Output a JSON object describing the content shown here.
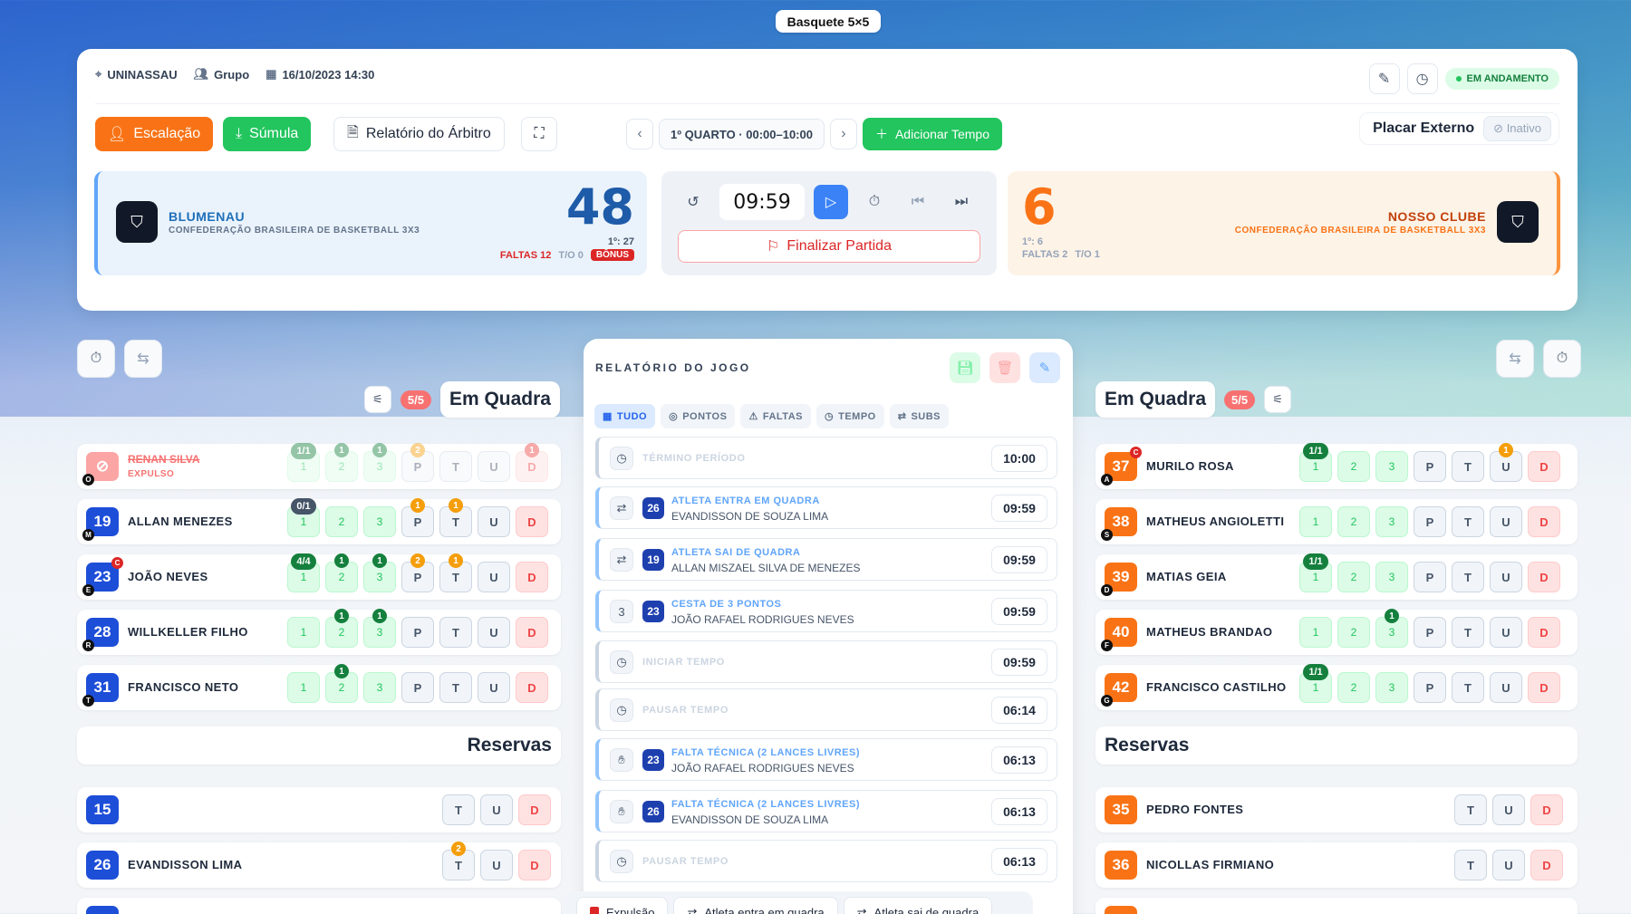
{
  "app": {
    "title": "Basquete 5×5"
  },
  "header": {
    "location": "UNINASSAU",
    "group": "Grupo",
    "datetime": "16/10/2023 14:30",
    "status": "EM ANDAMENTO"
  },
  "toolbar": {
    "escalacao": "Escalação",
    "sumula": "Súmula",
    "relatorio": "Relatório do Árbitro",
    "period": "1º QUARTO · 00:00–10:00",
    "add_time": "Adicionar Tempo",
    "placar_externo": "Placar Externo",
    "placar_state": "Inativo"
  },
  "teamA": {
    "name": "BLUMENAU",
    "sub": "CONFEDERAÇÃO BRASILEIRA DE BASKETBALL 3X3",
    "score": "48",
    "q": "1º: 27",
    "faltas": "FALTAS 12",
    "to": "T/O 0",
    "bonus": "BÔNUS"
  },
  "teamB": {
    "name": "NOSSO CLUBE",
    "sub": "CONFEDERAÇÃO BRASILEIRA DE BASKETBALL 3X3",
    "score": "6",
    "q": "1º: 6",
    "faltas": "FALTAS 2",
    "to": "T/O 1"
  },
  "clock": {
    "time": "09:59",
    "finalizar": "Finalizar Partida"
  },
  "left": {
    "title": "Em Quadra",
    "count": "5/5",
    "reservas": "Reservas"
  },
  "right": {
    "title": "Em Quadra",
    "count": "5/5",
    "reservas": "Reservas"
  },
  "keys": {
    "p1": "1",
    "p2": "2",
    "p3": "3",
    "P": "P",
    "T": "T",
    "U": "U",
    "D": "D"
  },
  "leftPlayers": [
    {
      "num": "",
      "name": "RENAN SILVA",
      "status": "EXPULSO",
      "pos": "O"
    },
    {
      "num": "19",
      "name": "ALLAN MENEZES",
      "pos": "M"
    },
    {
      "num": "23",
      "name": "JOÃO NEVES",
      "pos": "E",
      "cap": "C"
    },
    {
      "num": "28",
      "name": "WILLKELLER FILHO",
      "pos": "R"
    },
    {
      "num": "31",
      "name": "FRANCISCO NETO",
      "pos": "T"
    }
  ],
  "leftBadges": {
    "r0_1": "1/1",
    "r0_2": "1",
    "r0_3": "1",
    "r0_P": "2",
    "r0_D": "1",
    "r1_1": "0/1",
    "r1_P": "1",
    "r1_T": "1",
    "r2_1": "4/4",
    "r2_2": "1",
    "r2_3": "1",
    "r2_P": "2",
    "r2_T": "1",
    "r3_2": "1",
    "r3_3": "1",
    "r4_2": "1"
  },
  "leftReserves": [
    {
      "num": "15",
      "name": ""
    },
    {
      "num": "26",
      "name": "EVANDISSON LIMA",
      "badge": "2"
    }
  ],
  "rightPlayers": [
    {
      "num": "37",
      "name": "MURILO ROSA",
      "pos": "A",
      "cap": "C"
    },
    {
      "num": "38",
      "name": "MATHEUS ANGIOLETTI",
      "pos": "S"
    },
    {
      "num": "39",
      "name": "MATIAS GEIA",
      "pos": "D"
    },
    {
      "num": "40",
      "name": "MATHEUS BRANDAO",
      "pos": "F"
    },
    {
      "num": "42",
      "name": "FRANCISCO CASTILHO",
      "pos": "G"
    }
  ],
  "rightBadges": {
    "r0_1": "1/1",
    "r0_U": "1",
    "r2_1": "1/1",
    "r3_3": "1",
    "r4_1": "1/1"
  },
  "rightReserves": [
    {
      "num": "35",
      "name": "PEDRO FONTES"
    },
    {
      "num": "36",
      "name": "NICOLLAS FIRMIANO"
    }
  ],
  "report": {
    "title": "RELATÓRIO DO JOGO",
    "tabs": [
      "TUDO",
      "PONTOS",
      "FALTAS",
      "TEMPO",
      "SUBS"
    ],
    "events": [
      {
        "icon": "clock-icon",
        "title": "TÉRMINO PERÍODO",
        "time": "10:00",
        "gray": true
      },
      {
        "icon": "swap-icon",
        "num": "26",
        "title": "ATLETA ENTRA EM QUADRA",
        "who": "EVANDISSON DE SOUZA LIMA",
        "time": "09:59"
      },
      {
        "icon": "swap-icon",
        "num": "19",
        "title": "ATLETA SAI DE QUADRA",
        "who": "ALLAN MISZAEL SILVA DE MENEZES",
        "time": "09:59"
      },
      {
        "icon": "three-icon",
        "iconText": "3",
        "num": "23",
        "title": "CESTA DE 3 PONTOS",
        "who": "JOÃO RAFAEL RODRIGUES NEVES",
        "time": "09:59"
      },
      {
        "icon": "clock-icon",
        "title": "INICIAR TEMPO",
        "time": "09:59",
        "gray": true
      },
      {
        "icon": "clock-icon",
        "title": "PAUSAR TEMPO",
        "time": "06:14",
        "gray": true
      },
      {
        "icon": "hand-icon",
        "num": "23",
        "title": "FALTA TÉCNICA (2 LANCES LIVRES)",
        "who": "JOÃO RAFAEL RODRIGUES NEVES",
        "time": "06:13"
      },
      {
        "icon": "hand-icon",
        "num": "26",
        "title": "FALTA TÉCNICA (2 LANCES LIVRES)",
        "who": "EVANDISSON DE SOUZA LIMA",
        "time": "06:13"
      },
      {
        "icon": "clock-icon",
        "title": "PAUSAR TEMPO",
        "time": "06:13",
        "gray": true
      }
    ]
  },
  "bottom": {
    "b1": "Expulsão",
    "b2": "Atleta entra em quadra",
    "b3": "Atleta sai de quadra"
  }
}
